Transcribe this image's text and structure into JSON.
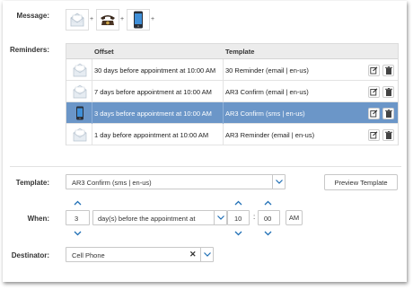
{
  "labels": {
    "message": "Message:",
    "reminders": "Reminders:",
    "template": "Template:",
    "when": "When:",
    "destinator": "Destinator:"
  },
  "message": {
    "icons": [
      "letter-icon",
      "telephone-icon",
      "mobile-phone-icon"
    ],
    "plus": "+"
  },
  "table": {
    "columns": [
      "Offset",
      "Template"
    ],
    "rows": [
      {
        "icon": "letter-icon",
        "offset": "30 days before appointment at 10:00 AM",
        "template": "30 Reminder (email | en-us)",
        "selected": false
      },
      {
        "icon": "letter-icon",
        "offset": "7 days before appointment at 10:00 AM",
        "template": "AR3 Confirm (email | en-us)",
        "selected": false
      },
      {
        "icon": "mobile-phone-icon",
        "offset": "3 days before appointment at 10:00 AM",
        "template": "AR3 Confirm (sms | en-us)",
        "selected": true
      },
      {
        "icon": "letter-icon",
        "offset": "1 day before appointment at 10:00 AM",
        "template": "AR3 Reminder (email | en-us)",
        "selected": false
      }
    ]
  },
  "template": {
    "value": "AR3 Confirm (sms | en-us)",
    "preview_label": "Preview Template"
  },
  "when": {
    "days": "3",
    "relation": "day(s) before the appointment at",
    "hour": "10",
    "colon": ":",
    "minute": "00",
    "ampm": "AM"
  },
  "destinator": {
    "value": "Cell Phone",
    "clear": "✕"
  },
  "colors": {
    "selected_row": "#6b96c8",
    "chevron": "#1f6fb5"
  }
}
